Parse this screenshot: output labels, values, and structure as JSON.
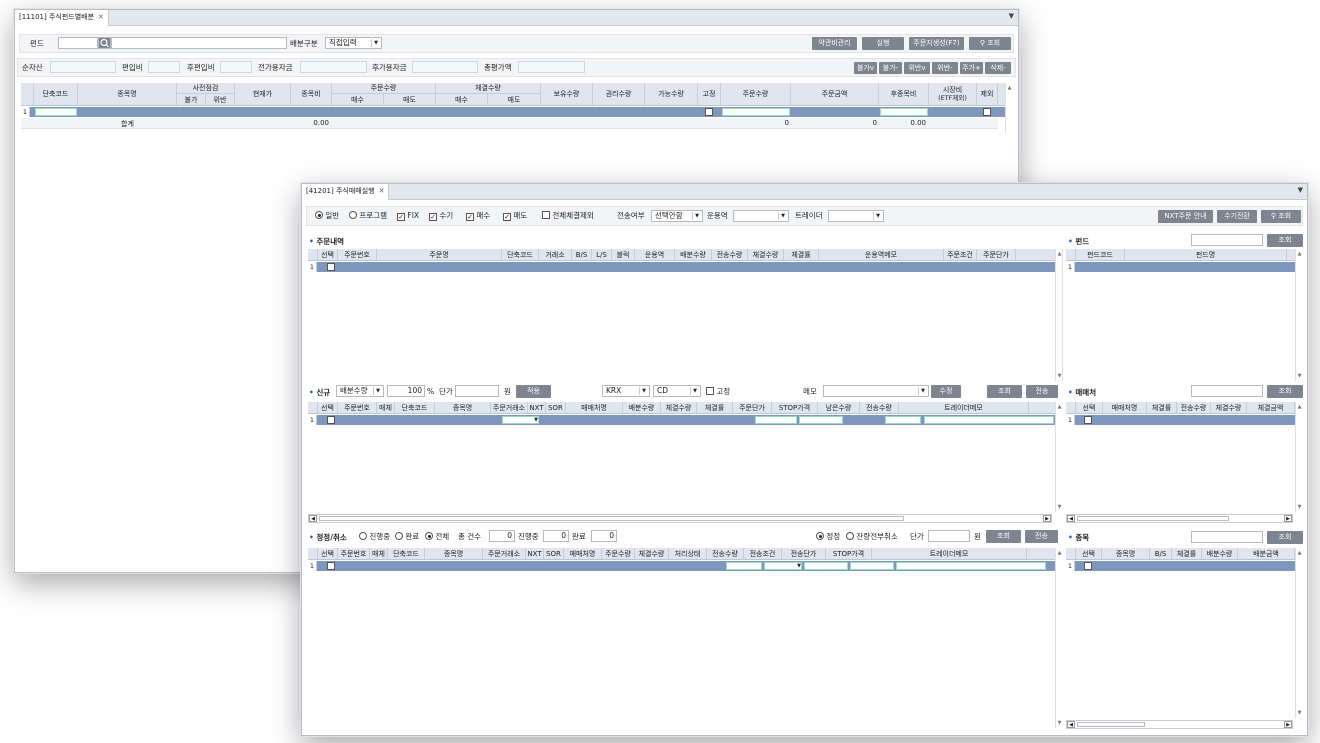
{
  "w1": {
    "tab_title": "[11101] 주식펀드별배분",
    "fund_label": "펀드",
    "alloc_label": "배분구분",
    "alloc_value": "직접입력",
    "buttons": [
      "약관비관리",
      "실행",
      "주문지생성(F7)",
      "조회"
    ],
    "row2": {
      "net_assets": "순자산",
      "incl_ratio": "편입비",
      "post_incl": "후편입비",
      "prev_funds": "전가용자금",
      "post_funds": "후가용자금",
      "total_val": "총평가액"
    },
    "small_buttons": [
      "불가v",
      "불가-",
      "위반v",
      "위반-",
      "주가+",
      "삭제-"
    ],
    "headers": {
      "code": "단축코드",
      "name": "종목명",
      "precheck": "사전점검",
      "impossible": "불가",
      "violation": "위반",
      "price": "현재가",
      "ratio": "종목비",
      "order_qty": "주문수량",
      "buy": "매수",
      "sell": "매도",
      "exec_qty": "체결수량",
      "hold": "보유수량",
      "rights": "권리수량",
      "avail": "가능수량",
      "fixed": "고정",
      "order_qty2": "주문수량",
      "order_amt": "주문금액",
      "post_ratio": "후종목비",
      "mktcap": "시장비",
      "mktcap_sub": "(ETF제외)",
      "exclude": "제외"
    },
    "row_num": "1",
    "total": {
      "label": "합계",
      "ratio": "0.00",
      "order_amt_left": "0",
      "order_amt": "0",
      "post_ratio": "0.00"
    }
  },
  "w2": {
    "tab_title": "[41201] 주식매매실행",
    "top": {
      "general": "일반",
      "program": "프로그램",
      "fix": "FIX",
      "manual": "수기",
      "buy": "매수",
      "sell": "매도",
      "exclude_all": "전체체결제외",
      "send_yn": "전송여부",
      "send_sel": "선택안함",
      "operator": "운용역",
      "trader": "트레이더",
      "btn_nxt": "NXT주문 안내",
      "btn_manual": "수기전환",
      "btn_search": "조회"
    },
    "orders": {
      "title": "주문내역",
      "headers": [
        "선택",
        "주문번호",
        "주문명",
        "단축코드",
        "거래소",
        "B/S",
        "L/S",
        "블럭",
        "운용역",
        "배분수량",
        "전송수량",
        "체결수량",
        "체결률",
        "운용역메모",
        "주문조건",
        "주문단가"
      ],
      "row_num": "1"
    },
    "fund_panel": {
      "title": "펀드",
      "search": "조회",
      "headers": [
        "펀드코드",
        "펀드명"
      ],
      "row_num": "1"
    },
    "new": {
      "title": "신규",
      "qty_sel": "배분수량",
      "pct": "100",
      "pct_unit": "%",
      "price": "단가",
      "won": "원",
      "apply": "적용",
      "exch": "KRX",
      "cd": "CD",
      "fixed": "고정",
      "memo": "메모",
      "modify": "수정",
      "search": "조회",
      "send": "전송",
      "headers": [
        "선택",
        "주문번호",
        "매체",
        "단축코드",
        "종목명",
        "주문거래소",
        "NXT",
        "SOR",
        "매매처명",
        "배분수량",
        "체결수량",
        "체결률",
        "주문단가",
        "STOP가격",
        "남은수량",
        "전송수량",
        "트레이더메모"
      ],
      "row_num": "1"
    },
    "broker_panel": {
      "title": "매매처",
      "search": "조회",
      "headers": [
        "선택",
        "매매처명",
        "체결률",
        "전송수량",
        "체결수량",
        "체결금액"
      ],
      "row_num": "1"
    },
    "cancel": {
      "title": "정정/취소",
      "pending": "진행중",
      "done": "완료",
      "all": "전체",
      "total_cnt": "총 건수",
      "cnt_total": "0",
      "in_prog": "진행중",
      "cnt_prog": "0",
      "completed": "완료",
      "cnt_done": "0",
      "correct": "정정",
      "remain_cancel": "잔량전부취소",
      "price": "단가",
      "won": "원",
      "search": "조회",
      "send": "전송",
      "headers": [
        "선택",
        "주문번호",
        "매체",
        "단축코드",
        "종목명",
        "주문거래소",
        "NXT",
        "SOR",
        "매매처명",
        "주문수량",
        "체결수량",
        "처리상태",
        "전송수량",
        "전송조건",
        "전송단가",
        "STOP가격",
        "트레이더메모"
      ],
      "row_num": "1"
    },
    "stock_panel": {
      "title": "종목",
      "search": "조회",
      "headers": [
        "선택",
        "종목명",
        "B/S",
        "체결률",
        "배분수량",
        "배분금액"
      ],
      "row_num": "1"
    }
  }
}
